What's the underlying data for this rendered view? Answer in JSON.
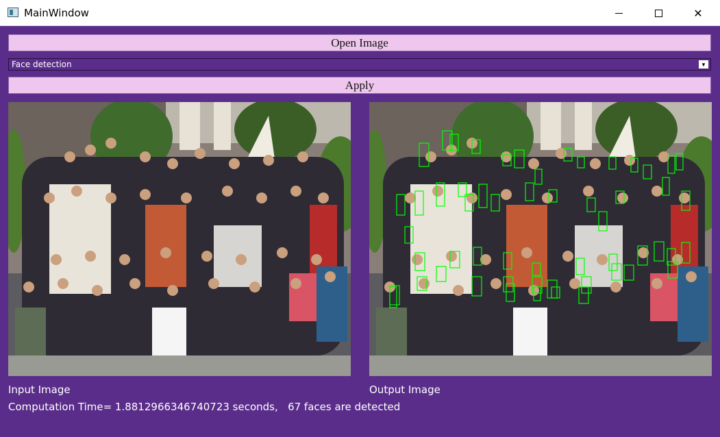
{
  "window": {
    "title": "MainWindow",
    "controls": {
      "minimize": "minimize-icon",
      "maximize": "maximize-icon",
      "close": "close-icon"
    }
  },
  "toolbar": {
    "open_label": "Open Image",
    "filter_selected": "Face detection",
    "apply_label": "Apply"
  },
  "panels": {
    "input_label": "Input Image",
    "output_label": "Output Image"
  },
  "status": {
    "text": "Computation Time= 1.8812966346740723 seconds,   67 faces are detected"
  },
  "colors": {
    "background": "#5a2d8a",
    "button": "#efc7ee",
    "face_box": "#00ff00"
  }
}
